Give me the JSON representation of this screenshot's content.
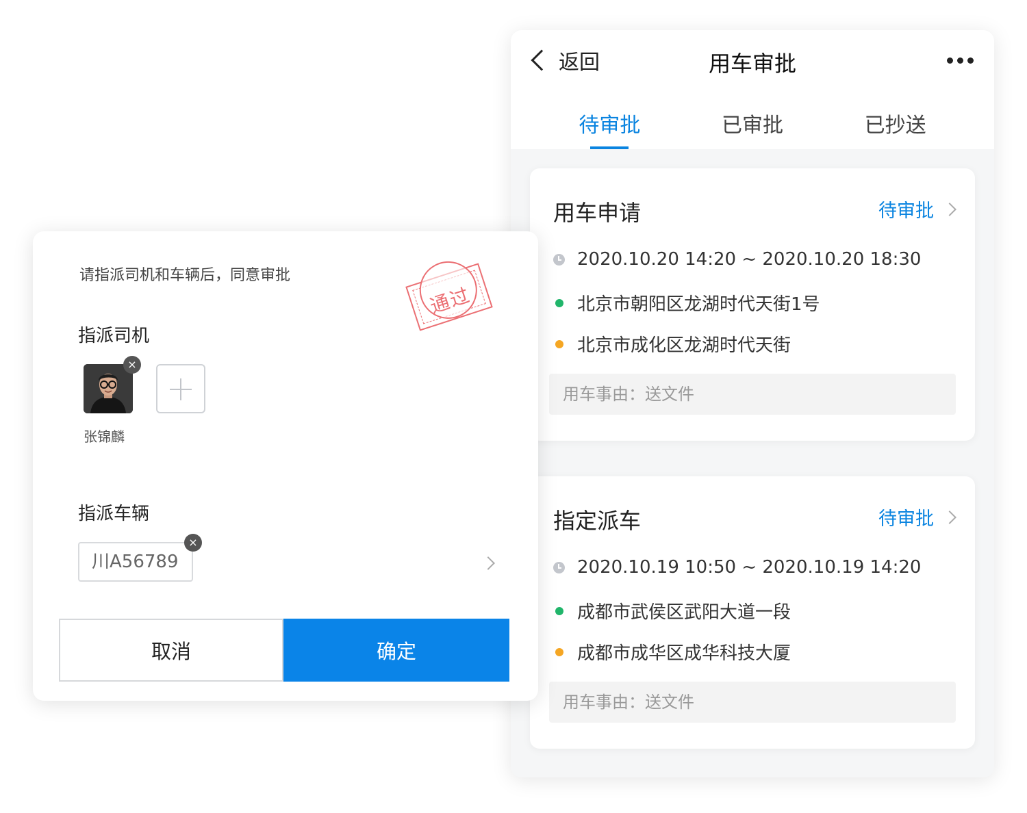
{
  "phone": {
    "back_label": "返回",
    "title": "用车审批",
    "tabs": [
      {
        "label": "待审批",
        "active": true
      },
      {
        "label": "已审批",
        "active": false
      },
      {
        "label": "已抄送",
        "active": false
      }
    ],
    "cards": [
      {
        "title": "用车申请",
        "status": "待审批",
        "time": "2020.10.20 14:20 ~ 2020.10.20 18:30",
        "start": "北京市朝阳区龙湖时代天街1号",
        "end": "北京市成化区龙湖时代天街",
        "reason": "用车事由：送文件"
      },
      {
        "title": "指定派车",
        "status": "待审批",
        "time": "2020.10.19 10:50 ~ 2020.10.19 14:20",
        "start": "成都市武侯区武阳大道一段",
        "end": "成都市成华区成华科技大厦",
        "reason": "用车事由：送文件"
      }
    ]
  },
  "dialog": {
    "hint": "请指派司机和车辆后，同意审批",
    "stamp_text": "通过",
    "driver_section": "指派司机",
    "driver_name": "张锦麟",
    "vehicle_section": "指派车辆",
    "plate": "川A56789",
    "cancel_label": "取消",
    "confirm_label": "确定",
    "remove_glyph": "×"
  },
  "colors": {
    "accent": "#0a84e8",
    "start_dot": "#20b56a",
    "end_dot": "#f5a623",
    "stamp": "#e8575b"
  }
}
